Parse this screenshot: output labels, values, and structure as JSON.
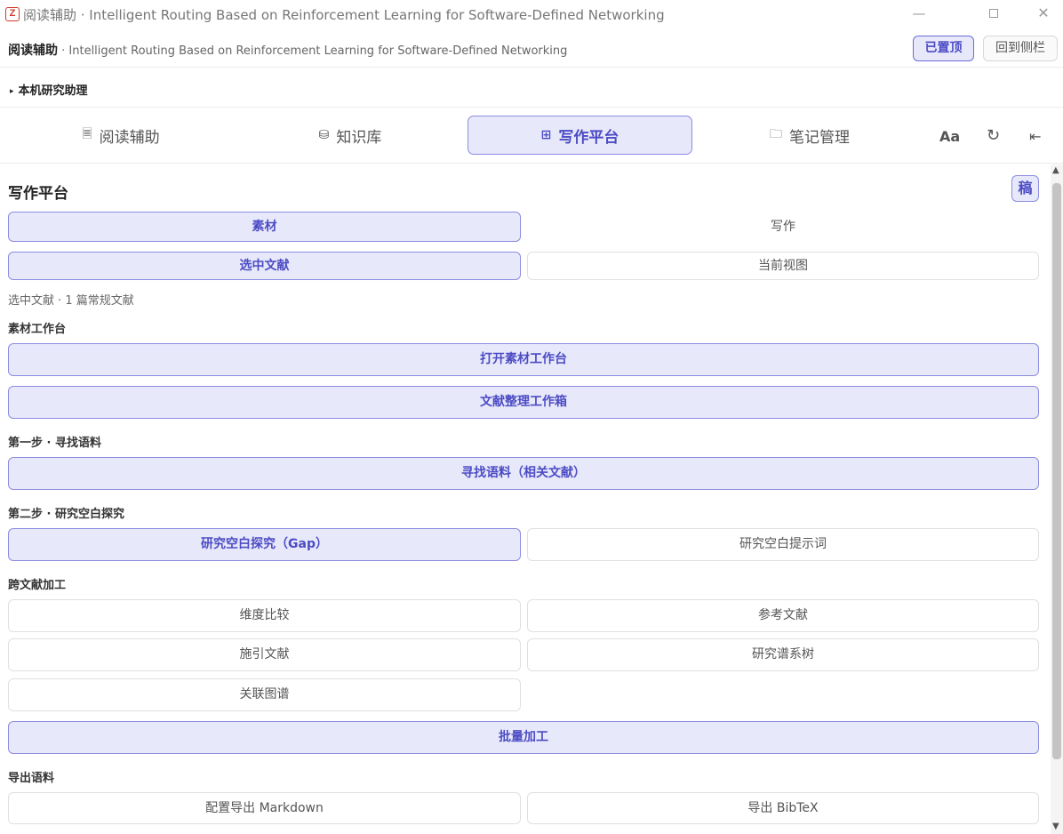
{
  "window": {
    "title": "阅读辅助 · Intelligent Routing Based on Reinforcement Learning for Software-Defined Networking",
    "logo_letter": "Z",
    "minimize": "—",
    "close": "✕"
  },
  "header": {
    "app_name": "阅读辅助",
    "paper_title": " · Intelligent Routing Based on Reinforcement Learning for Software-Defined Networking",
    "pin_label": "已置顶",
    "sidebar_label": "回到侧栏"
  },
  "assistant": {
    "caret": "▸",
    "label": "本机研究助理"
  },
  "tabs": [
    {
      "label": "阅读辅助",
      "icon": "document-icon",
      "glyph": "🗏"
    },
    {
      "label": "知识库",
      "icon": "database-icon",
      "glyph": "⛁"
    },
    {
      "label": "写作平台",
      "icon": "grid-icon",
      "glyph": "⊞"
    },
    {
      "label": "笔记管理",
      "icon": "folder-icon",
      "glyph": "🗀"
    }
  ],
  "toolbar": {
    "font_label": "Aa",
    "refresh_glyph": "↻",
    "collapse_glyph": "⇤"
  },
  "main": {
    "title": "写作平台",
    "draft_label": "稿",
    "mode_tabs": [
      "素材",
      "写作"
    ],
    "scope_tabs": [
      "选中文献",
      "当前视图"
    ],
    "selection_info": "选中文献 · 1 篇常规文献",
    "sections": {
      "workbench": {
        "title": "素材工作台",
        "buttons": [
          "打开素材工作台",
          "文献整理工作箱"
        ]
      },
      "step1": {
        "title": "第一步 · 寻找语料",
        "buttons": [
          "寻找语料（相关文献）"
        ]
      },
      "step2": {
        "title": "第二步 · 研究空白探究",
        "buttons": [
          "研究空白探究（Gap）",
          "研究空白提示词"
        ]
      },
      "cross": {
        "title": "跨文献加工",
        "buttons": [
          "维度比较",
          "参考文献",
          "施引文献",
          "研究谱系树",
          "关联图谱",
          "批量加工"
        ]
      },
      "export": {
        "title": "导出语料",
        "buttons": [
          "配置导出 Markdown",
          "导出 BibTeX"
        ]
      }
    }
  },
  "colors": {
    "accent": "#4c4cc4",
    "accent_bg": "#e8e8fb",
    "accent_border": "#8c8ce0"
  }
}
